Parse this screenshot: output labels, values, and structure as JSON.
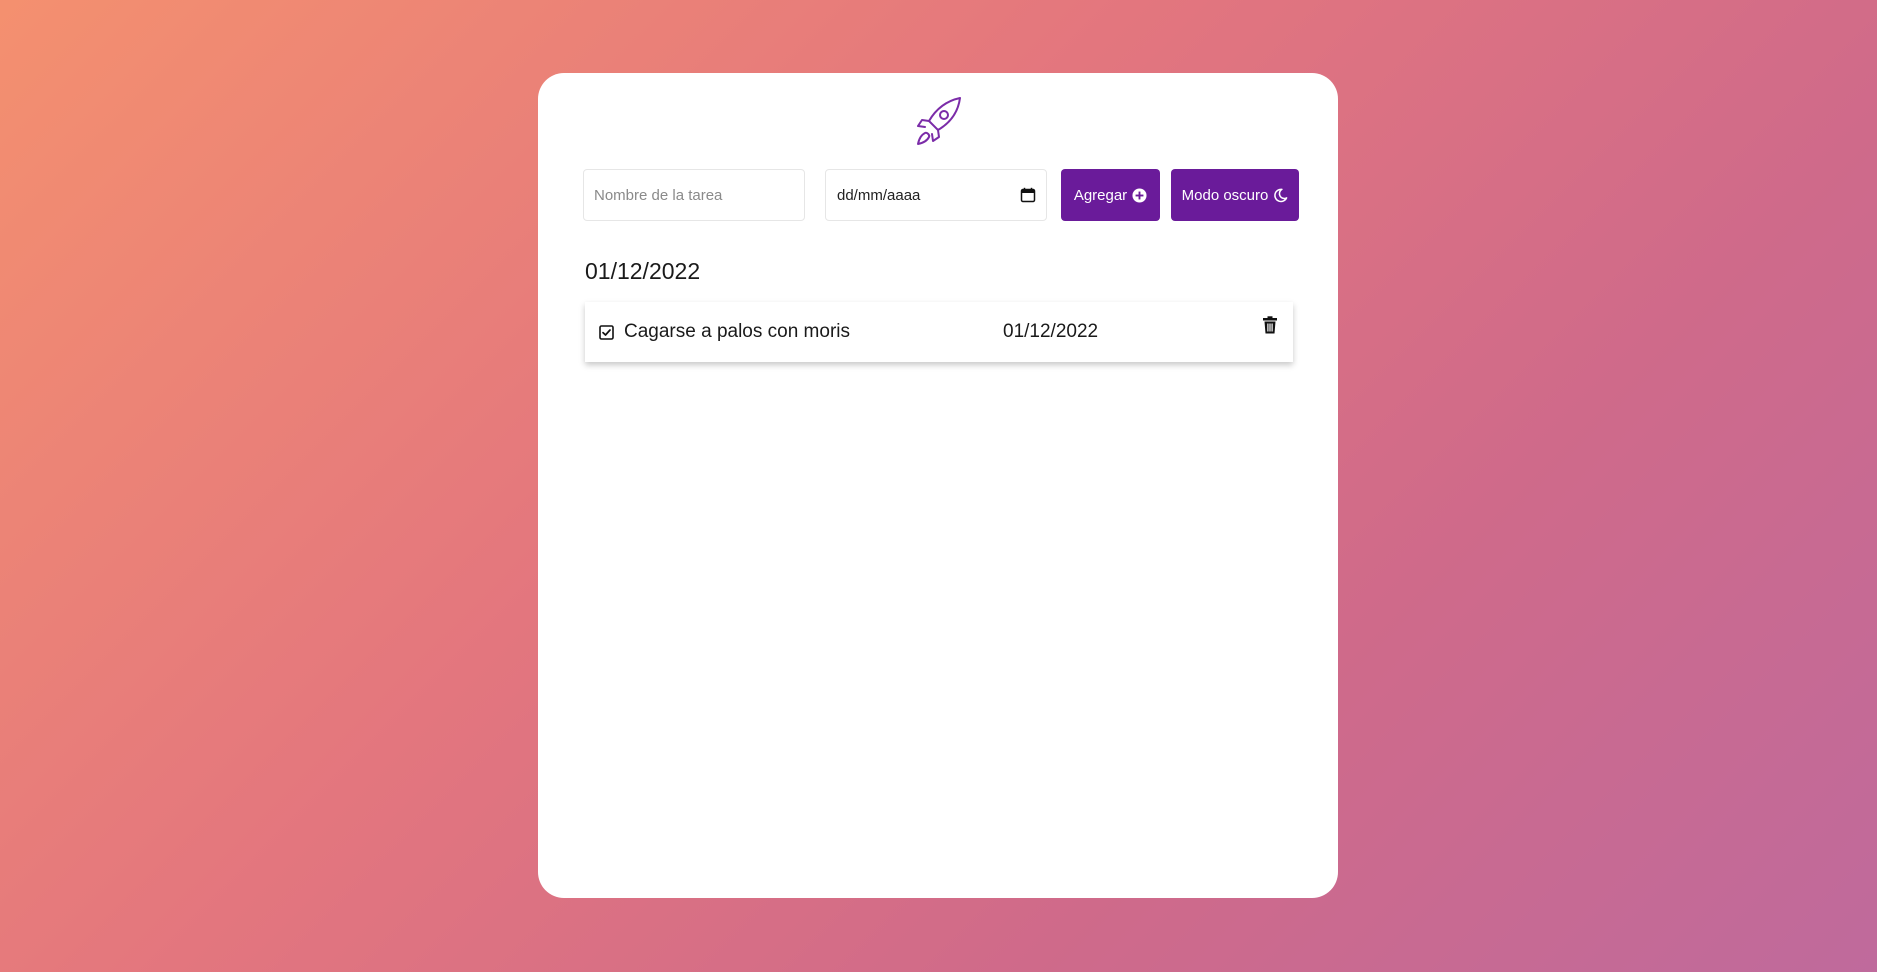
{
  "colors": {
    "accent": "#6a1b9a",
    "logo": "#7b2ca8",
    "card": "#ffffff",
    "text": "#1a1a1a"
  },
  "header": {
    "logo_icon": "rocket-icon"
  },
  "form": {
    "task_placeholder": "Nombre de la tarea",
    "task_value": "",
    "date_placeholder": "dd/mm/aaaa",
    "date_icon": "calendar-icon",
    "add_label": "Agregar",
    "add_icon": "plus-circle-icon",
    "dark_mode_label": "Modo oscuro",
    "dark_mode_icon": "moon-icon"
  },
  "groups": [
    {
      "date": "01/12/2022",
      "tasks": [
        {
          "name": "Cagarse a palos con moris",
          "date": "01/12/2022",
          "checked": true,
          "check_icon": "checkbox-checked-icon",
          "delete_icon": "trash-icon"
        }
      ]
    }
  ]
}
